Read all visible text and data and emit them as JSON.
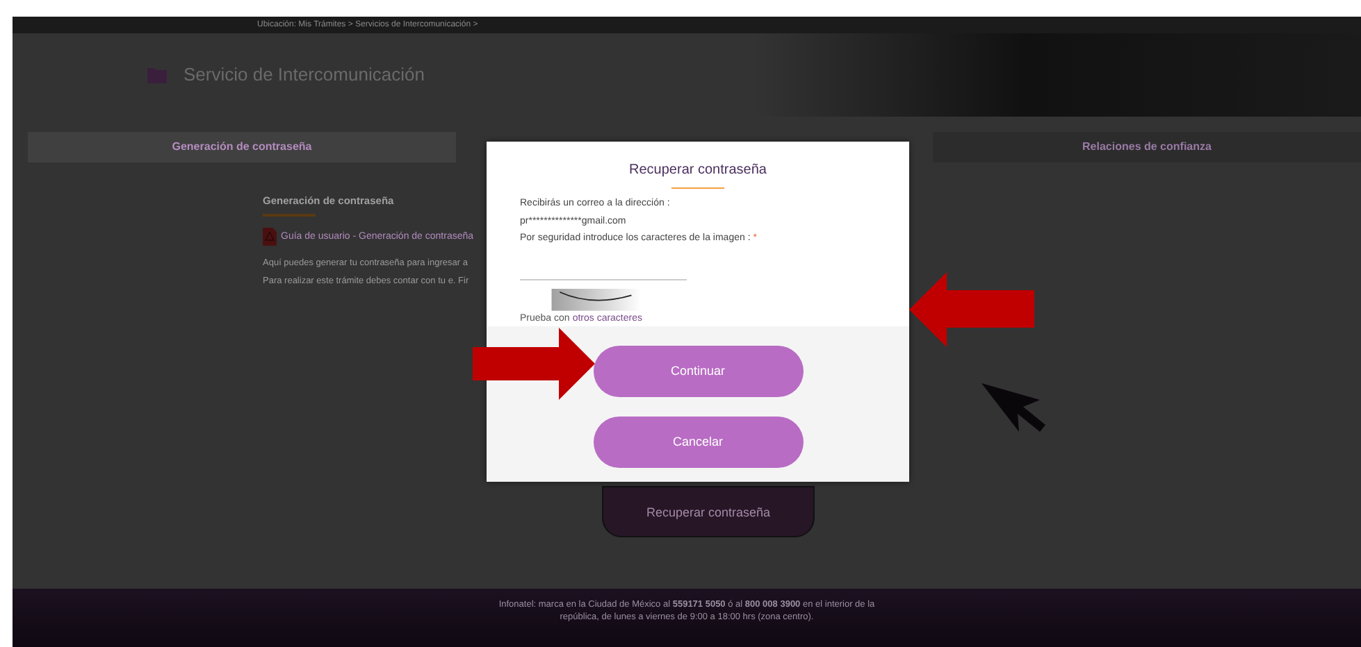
{
  "breadcrumb": "Ubicación: Mis Trámites > Servicios de Intercomunicación >",
  "header": {
    "title": "Servicio de Intercomunicación"
  },
  "tabs": [
    {
      "label": "Generación de contraseña",
      "selected": true
    },
    {
      "label": "Relaciones de confianza",
      "selected": false
    }
  ],
  "content": {
    "heading": "Generación de contraseña",
    "guide_link": "Guía de usuario - Generación de contraseña",
    "paragraphs": [
      "Aquí puedes generar tu contraseña para ingresar a",
      "Para realizar este trámite debes contar con tu e. Fir"
    ]
  },
  "background_button": "Recuperar contraseña",
  "footer": "Infonatel: marca en la Ciudad de México al **559171 5050** ó al **800 008 3900** en el interior de la república, de lunes a viernes de 9:00 a 18:00 hrs (zona centro).",
  "dialog": {
    "title": "Recuperar contraseña",
    "lines": [
      "Recibirás un correo a la dirección :",
      "pr**************gmail.com"
    ],
    "captcha_prompt": "Por seguridad introduce los caracteres de la imagen :",
    "required_mark": "*",
    "retry_text": "Prueba con",
    "retry_link": "otros caracteres",
    "buttons": [
      {
        "label": "Continuar"
      },
      {
        "label": "Cancelar"
      }
    ]
  }
}
